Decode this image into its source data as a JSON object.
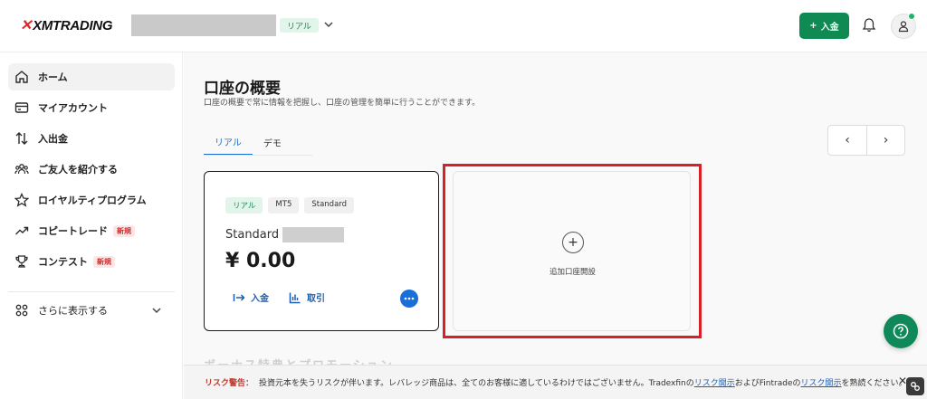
{
  "header": {
    "logo_text": "XMTRADING",
    "account_type_badge": "リアル",
    "deposit_button": "入金"
  },
  "sidebar": {
    "items": [
      {
        "label": "ホーム",
        "icon": "home-icon"
      },
      {
        "label": "マイアカウント",
        "icon": "card-icon"
      },
      {
        "label": "入出金",
        "icon": "transfer-icon"
      },
      {
        "label": "ご友人を紹介する",
        "icon": "users-icon"
      },
      {
        "label": "ロイヤルティプログラム",
        "icon": "star-icon"
      },
      {
        "label": "コピートレード",
        "icon": "trend-icon",
        "badge": "新規"
      },
      {
        "label": "コンテスト",
        "icon": "trophy-icon",
        "badge": "新規"
      }
    ],
    "more_label": "さらに表示する"
  },
  "main": {
    "title": "口座の概要",
    "subtitle": "口座の概要で常に情報を把握し、口座の管理を簡単に行うことができます。",
    "tabs": [
      {
        "label": "リアル",
        "active": true
      },
      {
        "label": "デモ",
        "active": false
      }
    ],
    "pager": {
      "prev": "‹",
      "next": "›"
    },
    "account_card": {
      "chips": [
        "リアル",
        "MT5",
        "Standard"
      ],
      "name": "Standard",
      "balance": "¥ 0.00",
      "deposit_label": "入金",
      "history_label": "取引"
    },
    "add_card": {
      "plus": "+",
      "label": "追加口座開設"
    },
    "promo_peek": "ボーナス特典とプロモーション"
  },
  "risk": {
    "label": "リスク警告：",
    "text1": "投資元本を失うリスクが伴います。レバレッジ商品は、全てのお客様に適しているわけではございません。Tradexfinの",
    "link1": "リスク開示",
    "text2": "およびFintradeの",
    "link2": "リスク開示",
    "text3": "を熟読ください。",
    "close": "✕"
  },
  "colors": {
    "brand_green": "#0f8a53",
    "link_blue": "#1a6ed8",
    "highlight_red": "#d72028"
  }
}
